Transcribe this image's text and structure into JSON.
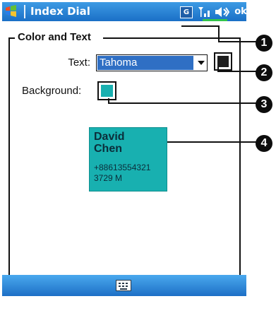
{
  "titlebar": {
    "title": "Index Dial",
    "status_g": "G",
    "ok": "ok"
  },
  "group": {
    "title": "Color and Text"
  },
  "text_row": {
    "label": "Text:",
    "font_value": "Tahoma",
    "text_color": "#1d1d1d"
  },
  "background_row": {
    "label": "Background:",
    "background_color": "#18b0b0"
  },
  "preview": {
    "first_name": "David",
    "last_name": "Chen",
    "phone": "+88613554321",
    "room": "3729 M"
  },
  "callouts": [
    "1",
    "2",
    "3",
    "4"
  ],
  "icons": [
    "windows-logo-icon",
    "signal-icon",
    "volume-icon",
    "battery-icon",
    "keyboard-icon"
  ]
}
